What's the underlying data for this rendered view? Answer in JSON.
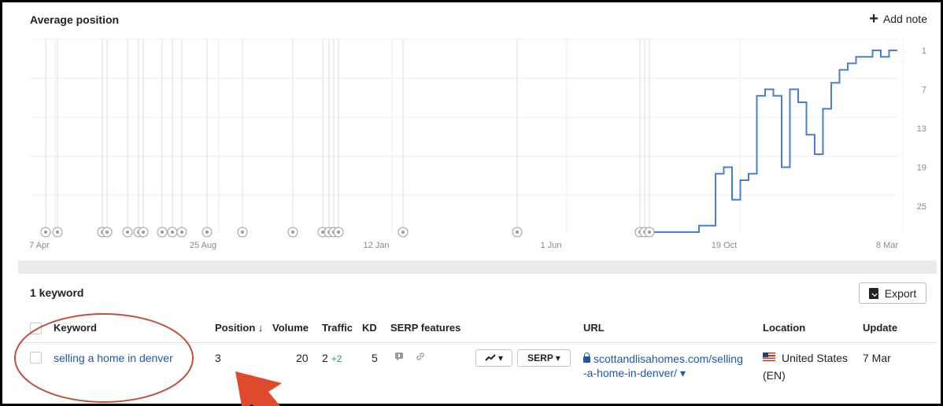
{
  "header": {
    "chart_title": "Average position",
    "add_note_label": "Add note"
  },
  "chart_data": {
    "type": "line",
    "title": "Average position",
    "x_tick_labels": [
      "7 Apr",
      "25 Aug",
      "12 Jan",
      "1 Jun",
      "19 Oct",
      "8 Mar"
    ],
    "y_tick_labels": [
      "1",
      "7",
      "13",
      "19",
      "25"
    ],
    "ylim": [
      1,
      29
    ],
    "y_inverted": true,
    "grid": true,
    "series": [
      {
        "color": "#4a7fcf",
        "x": [
          0,
          6,
          6,
          8,
          8,
          9,
          9,
          10,
          10,
          11,
          11,
          12,
          12,
          13,
          13,
          14,
          14,
          15,
          15,
          16,
          16,
          17,
          17,
          18,
          18,
          19,
          19,
          20,
          20,
          21,
          21,
          22,
          22,
          23,
          23,
          24,
          24,
          25,
          25,
          26,
          26,
          27,
          27,
          28,
          28,
          29,
          29,
          30,
          30
        ],
        "y": [
          29,
          29,
          28,
          28,
          20,
          20,
          19,
          19,
          24,
          24,
          21,
          21,
          20,
          20,
          8,
          8,
          7,
          7,
          8,
          8,
          19,
          19,
          7,
          7,
          9,
          9,
          14,
          14,
          17,
          17,
          10,
          10,
          6,
          6,
          4,
          4,
          3,
          3,
          2,
          2,
          2,
          2,
          1,
          1,
          2,
          2,
          1,
          1,
          1
        ]
      }
    ],
    "annotation_markers": 24
  },
  "table": {
    "count_label": "1 keyword",
    "export_label": "Export",
    "headers": {
      "keyword": "Keyword",
      "position": "Position ↓",
      "volume": "Volume",
      "traffic": "Traffic",
      "kd": "KD",
      "serp_features": "SERP features",
      "url": "URL",
      "location": "Location",
      "update": "Update"
    },
    "rows": [
      {
        "keyword": "selling a home in denver",
        "position": "3",
        "volume": "20",
        "traffic": "2",
        "traffic_delta": "+2",
        "kd": "5",
        "chart_btn_label": "▾",
        "serp_btn_label": "SERP",
        "serp_btn_caret": "▾",
        "url_line1": "scottandlisahomes.com/selling",
        "url_line2": "-a-home-in-denver/",
        "url_caret": "▾",
        "location_line1": "United States",
        "location_line2": "(EN)",
        "update": "7 Mar"
      }
    ]
  },
  "colors": {
    "line": "#4a7fcf",
    "link": "#2057a8",
    "annotation": "#e04a2c"
  }
}
